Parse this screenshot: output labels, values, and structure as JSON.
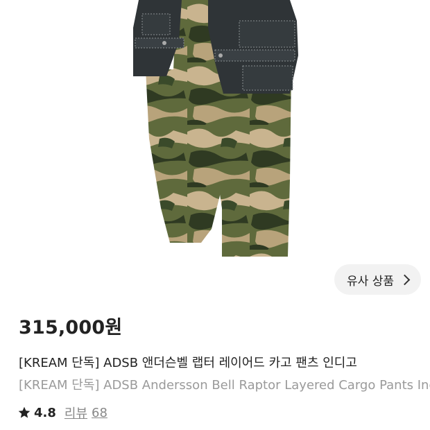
{
  "similar": {
    "label": "유사 상품"
  },
  "product": {
    "price": "315,000원",
    "title_ko": "[KREAM 단독] ADSB 앤더슨벨 랩터 레이어드 카고 팬츠 인디고",
    "title_en": "[KREAM 단독] ADSB Andersson Bell Raptor Layered Cargo Pants Indigo"
  },
  "rating": {
    "score": "4.8",
    "review_label": "리뷰",
    "review_count": "68"
  },
  "colors": {
    "denim": "#2f3437",
    "camo_dark": "#3d4a2c",
    "camo_olive": "#6b6c3f",
    "camo_tan": "#c9b48f"
  }
}
